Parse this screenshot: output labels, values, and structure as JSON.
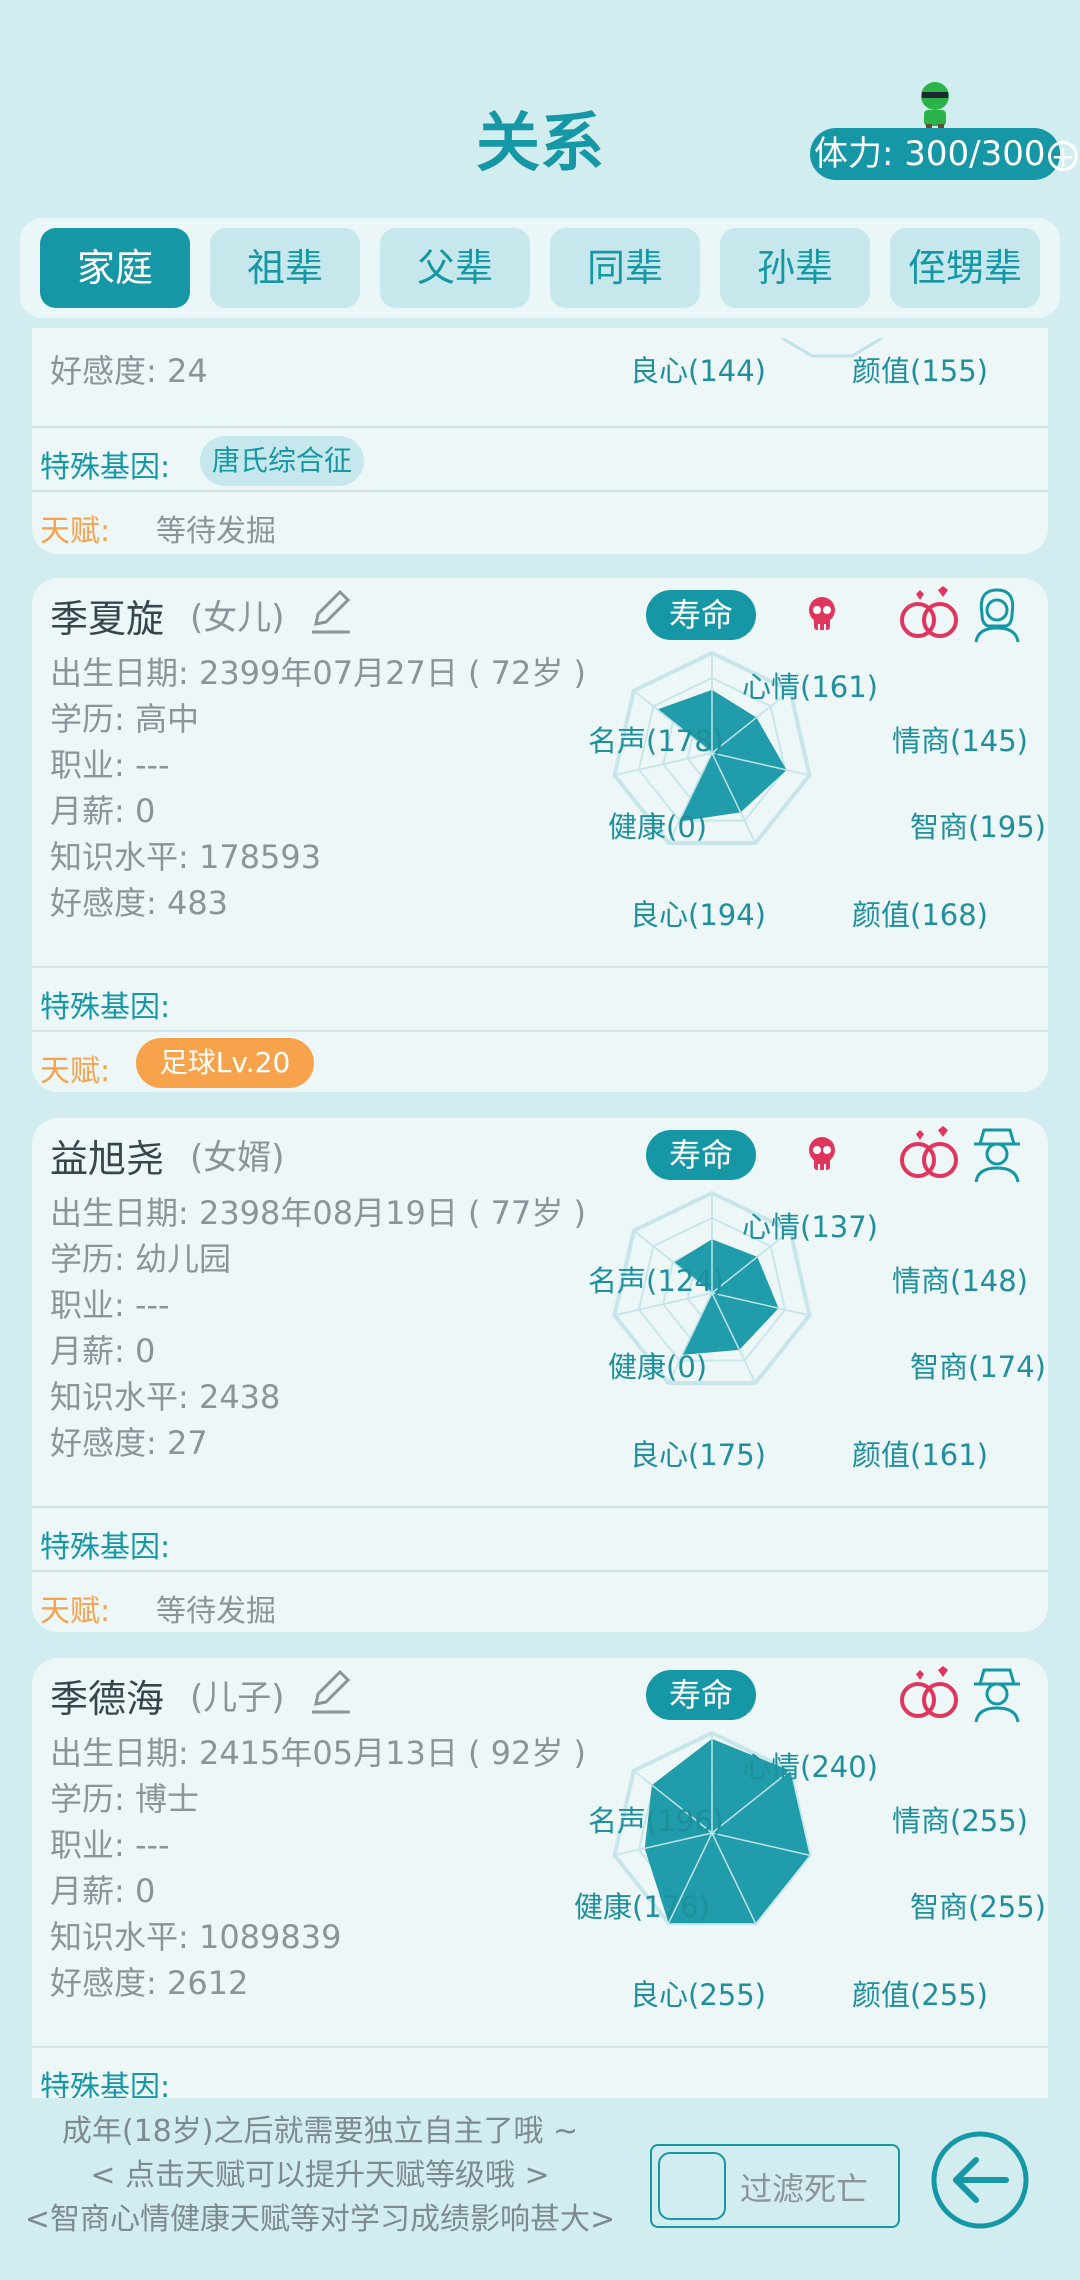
{
  "header": {
    "title": "关系",
    "stamina": "体力: 300/300"
  },
  "tabs": [
    {
      "label": "家庭",
      "active": true
    },
    {
      "label": "祖辈",
      "active": false
    },
    {
      "label": "父辈",
      "active": false
    },
    {
      "label": "同辈",
      "active": false
    },
    {
      "label": "孙辈",
      "active": false
    },
    {
      "label": "侄甥辈",
      "active": false
    }
  ],
  "partial_card": {
    "affinity": "好感度: 24",
    "label_conscience": "良心(144)",
    "label_looks": "颜值(155)",
    "gene_label": "特殊基因:",
    "gene_tag": "唐氏综合征",
    "talent_label": "天赋:",
    "talent_text": "等待发掘"
  },
  "cards": [
    {
      "name": "季夏旋",
      "relation": "(女儿)",
      "lifespan": "寿命",
      "birth": "出生日期: 2399年07月27日 ( 72岁 )",
      "education": "学历: 高中",
      "job": "职业: ---",
      "salary": "月薪:  0",
      "knowledge": "知识水平: 178593",
      "affinity": "好感度: 483",
      "stats": {
        "mood": 161,
        "eq": 145,
        "iq": 195,
        "looks": 168,
        "conscience": 194,
        "health": 0,
        "fame": 178
      },
      "labels": {
        "mood": "心情(161)",
        "eq": "情商(145)",
        "iq": "智商(195)",
        "looks": "颜值(168)",
        "conscience": "良心(194)",
        "health": "健康(0)",
        "fame": "名声(178)"
      },
      "gene_label": "特殊基因:",
      "talent_label": "天赋:",
      "talent_tag": "足球Lv.20"
    },
    {
      "name": "益旭尧",
      "relation": "(女婿)",
      "lifespan": "寿命",
      "birth": "出生日期: 2398年08月19日 ( 77岁 )",
      "education": "学历: 幼儿园",
      "job": "职业: ---",
      "salary": "月薪:  0",
      "knowledge": "知识水平: 2438",
      "affinity": "好感度: 27",
      "stats": {
        "mood": 137,
        "eq": 148,
        "iq": 174,
        "looks": 161,
        "conscience": 175,
        "health": 0,
        "fame": 124
      },
      "labels": {
        "mood": "心情(137)",
        "eq": "情商(148)",
        "iq": "智商(174)",
        "looks": "颜值(161)",
        "conscience": "良心(175)",
        "health": "健康(0)",
        "fame": "名声(124)"
      },
      "gene_label": "特殊基因:",
      "talent_label": "天赋:",
      "talent_text": "等待发掘"
    },
    {
      "name": "季德海",
      "relation": "(儿子)",
      "lifespan": "寿命",
      "birth": "出生日期: 2415年05月13日 ( 92岁 )",
      "education": "学历: 博士",
      "job": "职业: ---",
      "salary": "月薪:  0",
      "knowledge": "知识水平: 1089839",
      "affinity": "好感度: 2612",
      "stats": {
        "mood": 240,
        "eq": 255,
        "iq": 255,
        "looks": 255,
        "conscience": 255,
        "health": 176,
        "fame": 196
      },
      "labels": {
        "mood": "心情(240)",
        "eq": "情商(255)",
        "iq": "智商(255)",
        "looks": "颜值(255)",
        "conscience": "良心(255)",
        "health": "健康(176)",
        "fame": "名声(196)"
      },
      "gene_label": "特殊基因:"
    }
  ],
  "footer": {
    "hint1": "成年(18岁)之后就需要独立自主了哦 ~",
    "hint2": "< 点击天赋可以提升天赋等级哦 >",
    "hint3": "<智商心情健康天赋等对学习成绩影响甚大>",
    "filter_label": "过滤死亡"
  },
  "colors": {
    "accent": "#1597a5",
    "talent": "#f7a34c",
    "background": "#d2edf0",
    "card": "#eef7f8"
  }
}
